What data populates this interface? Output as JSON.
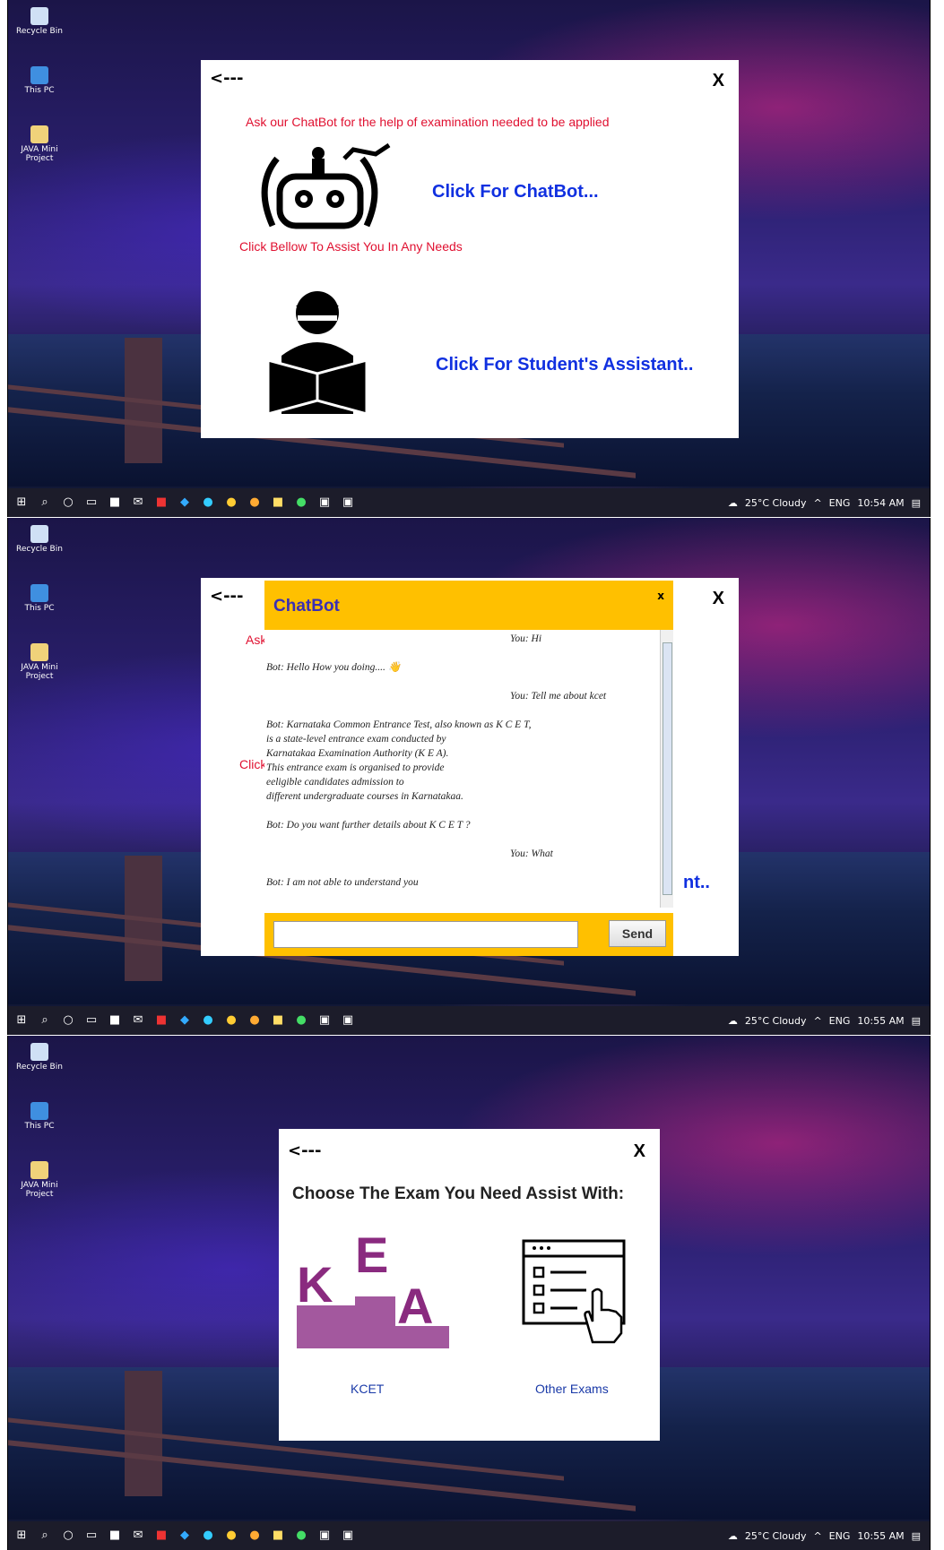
{
  "desktop": {
    "icons": [
      "Recycle Bin",
      "This PC",
      "JAVA Mini\nProject"
    ]
  },
  "taskbar": {
    "weather": "25°C  Cloudy",
    "lang": "ENG",
    "times": [
      "10:54 AM",
      "10:55 AM",
      "10:55 AM"
    ]
  },
  "screen1": {
    "back": "<---",
    "close": "X",
    "chatbot_prompt": "Ask our ChatBot for the help of examination needed to be applied",
    "chatbot_link": "Click For ChatBot...",
    "assist_prompt": "Click Bellow To Assist You In Any Needs",
    "assistant_link": "Click For Student's Assistant.."
  },
  "screen2": {
    "back": "<---",
    "close": "X",
    "partial_ask": "Ask",
    "partial_click": "Click",
    "partial_link": "nt..",
    "chatbot": {
      "title": "ChatBot",
      "close": "x",
      "messages": [
        {
          "side": "user",
          "text": "You: Hi"
        },
        {
          "side": "bot",
          "text": "Bot: Hello How you doing.... 👋"
        },
        {
          "side": "user",
          "text": "You: Tell me about kcet"
        },
        {
          "side": "bot",
          "text": "Bot: Karnataka Common Entrance Test, also known as K C E T,\nis a state-level entrance exam conducted by\nKarnatakaa Examination Authority (K E A).\nThis entrance exam is organised to provide\neeligible candidates admission to\ndifferent undergraduate courses in Karnatakaa."
        },
        {
          "side": "bot",
          "text": "Bot: Do you want further details about K C E T ?"
        },
        {
          "side": "user",
          "text": "You: What"
        },
        {
          "side": "bot",
          "text": "Bot: I am not able to understand you"
        }
      ],
      "input_value": "",
      "send": "Send"
    }
  },
  "screen3": {
    "back": "<---",
    "close": "X",
    "title": "Choose The Exam You Need Assist With:",
    "kea_letters": [
      "K",
      "E",
      "A"
    ],
    "kcet_label": "KCET",
    "other_label": "Other Exams"
  },
  "colors": {
    "prompt_red": "#e01030",
    "link_blue": "#1030e0",
    "chat_yellow": "#ffc000",
    "kea_purple": "#a3589e"
  },
  "icons": [
    "robot-icon",
    "student-reading-icon",
    "kea-logo",
    "checklist-touch-icon",
    "windows-start-icon",
    "search-icon"
  ]
}
